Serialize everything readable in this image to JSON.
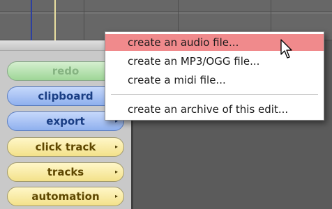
{
  "side_buttons": [
    {
      "label": "redo",
      "has_submenu": false,
      "color": "#9ed697"
    },
    {
      "label": "clipboard",
      "has_submenu": true,
      "color": "#8fb0ee"
    },
    {
      "label": "export",
      "has_submenu": true,
      "color": "#8fb0ee"
    },
    {
      "label": "click track",
      "has_submenu": true,
      "color": "#f3e18a"
    },
    {
      "label": "tracks",
      "has_submenu": true,
      "color": "#f3e18a"
    },
    {
      "label": "automation",
      "has_submenu": true,
      "color": "#f3e18a"
    }
  ],
  "submenu_arrow_glyph": "▸",
  "export_menu": {
    "items": [
      {
        "label": "create an audio file...",
        "highlighted": true
      },
      {
        "label": "create an MP3/OGG file...",
        "highlighted": false
      },
      {
        "label": "create a midi file...",
        "highlighted": false
      },
      {
        "label": "create an archive of this edit...",
        "highlighted": false
      }
    ],
    "highlight_color": "#f08a8c"
  },
  "playhead_colors": {
    "blue": "#2c3fa0",
    "yellow": "#e9dfa0"
  }
}
